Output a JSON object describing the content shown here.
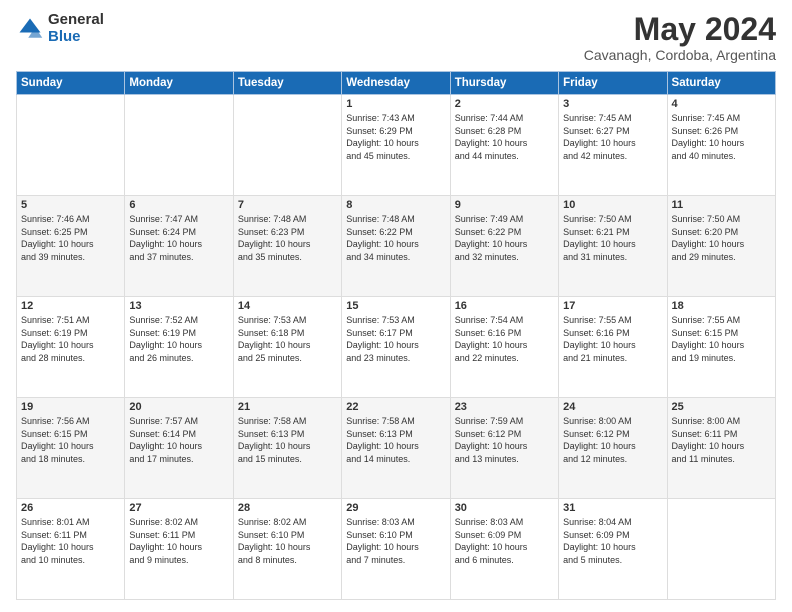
{
  "header": {
    "logo_general": "General",
    "logo_blue": "Blue",
    "main_title": "May 2024",
    "subtitle": "Cavanagh, Cordoba, Argentina"
  },
  "calendar": {
    "days_of_week": [
      "Sunday",
      "Monday",
      "Tuesday",
      "Wednesday",
      "Thursday",
      "Friday",
      "Saturday"
    ],
    "weeks": [
      [
        {
          "day": "",
          "info": ""
        },
        {
          "day": "",
          "info": ""
        },
        {
          "day": "",
          "info": ""
        },
        {
          "day": "1",
          "info": "Sunrise: 7:43 AM\nSunset: 6:29 PM\nDaylight: 10 hours\nand 45 minutes."
        },
        {
          "day": "2",
          "info": "Sunrise: 7:44 AM\nSunset: 6:28 PM\nDaylight: 10 hours\nand 44 minutes."
        },
        {
          "day": "3",
          "info": "Sunrise: 7:45 AM\nSunset: 6:27 PM\nDaylight: 10 hours\nand 42 minutes."
        },
        {
          "day": "4",
          "info": "Sunrise: 7:45 AM\nSunset: 6:26 PM\nDaylight: 10 hours\nand 40 minutes."
        }
      ],
      [
        {
          "day": "5",
          "info": "Sunrise: 7:46 AM\nSunset: 6:25 PM\nDaylight: 10 hours\nand 39 minutes."
        },
        {
          "day": "6",
          "info": "Sunrise: 7:47 AM\nSunset: 6:24 PM\nDaylight: 10 hours\nand 37 minutes."
        },
        {
          "day": "7",
          "info": "Sunrise: 7:48 AM\nSunset: 6:23 PM\nDaylight: 10 hours\nand 35 minutes."
        },
        {
          "day": "8",
          "info": "Sunrise: 7:48 AM\nSunset: 6:22 PM\nDaylight: 10 hours\nand 34 minutes."
        },
        {
          "day": "9",
          "info": "Sunrise: 7:49 AM\nSunset: 6:22 PM\nDaylight: 10 hours\nand 32 minutes."
        },
        {
          "day": "10",
          "info": "Sunrise: 7:50 AM\nSunset: 6:21 PM\nDaylight: 10 hours\nand 31 minutes."
        },
        {
          "day": "11",
          "info": "Sunrise: 7:50 AM\nSunset: 6:20 PM\nDaylight: 10 hours\nand 29 minutes."
        }
      ],
      [
        {
          "day": "12",
          "info": "Sunrise: 7:51 AM\nSunset: 6:19 PM\nDaylight: 10 hours\nand 28 minutes."
        },
        {
          "day": "13",
          "info": "Sunrise: 7:52 AM\nSunset: 6:19 PM\nDaylight: 10 hours\nand 26 minutes."
        },
        {
          "day": "14",
          "info": "Sunrise: 7:53 AM\nSunset: 6:18 PM\nDaylight: 10 hours\nand 25 minutes."
        },
        {
          "day": "15",
          "info": "Sunrise: 7:53 AM\nSunset: 6:17 PM\nDaylight: 10 hours\nand 23 minutes."
        },
        {
          "day": "16",
          "info": "Sunrise: 7:54 AM\nSunset: 6:16 PM\nDaylight: 10 hours\nand 22 minutes."
        },
        {
          "day": "17",
          "info": "Sunrise: 7:55 AM\nSunset: 6:16 PM\nDaylight: 10 hours\nand 21 minutes."
        },
        {
          "day": "18",
          "info": "Sunrise: 7:55 AM\nSunset: 6:15 PM\nDaylight: 10 hours\nand 19 minutes."
        }
      ],
      [
        {
          "day": "19",
          "info": "Sunrise: 7:56 AM\nSunset: 6:15 PM\nDaylight: 10 hours\nand 18 minutes."
        },
        {
          "day": "20",
          "info": "Sunrise: 7:57 AM\nSunset: 6:14 PM\nDaylight: 10 hours\nand 17 minutes."
        },
        {
          "day": "21",
          "info": "Sunrise: 7:58 AM\nSunset: 6:13 PM\nDaylight: 10 hours\nand 15 minutes."
        },
        {
          "day": "22",
          "info": "Sunrise: 7:58 AM\nSunset: 6:13 PM\nDaylight: 10 hours\nand 14 minutes."
        },
        {
          "day": "23",
          "info": "Sunrise: 7:59 AM\nSunset: 6:12 PM\nDaylight: 10 hours\nand 13 minutes."
        },
        {
          "day": "24",
          "info": "Sunrise: 8:00 AM\nSunset: 6:12 PM\nDaylight: 10 hours\nand 12 minutes."
        },
        {
          "day": "25",
          "info": "Sunrise: 8:00 AM\nSunset: 6:11 PM\nDaylight: 10 hours\nand 11 minutes."
        }
      ],
      [
        {
          "day": "26",
          "info": "Sunrise: 8:01 AM\nSunset: 6:11 PM\nDaylight: 10 hours\nand 10 minutes."
        },
        {
          "day": "27",
          "info": "Sunrise: 8:02 AM\nSunset: 6:11 PM\nDaylight: 10 hours\nand 9 minutes."
        },
        {
          "day": "28",
          "info": "Sunrise: 8:02 AM\nSunset: 6:10 PM\nDaylight: 10 hours\nand 8 minutes."
        },
        {
          "day": "29",
          "info": "Sunrise: 8:03 AM\nSunset: 6:10 PM\nDaylight: 10 hours\nand 7 minutes."
        },
        {
          "day": "30",
          "info": "Sunrise: 8:03 AM\nSunset: 6:09 PM\nDaylight: 10 hours\nand 6 minutes."
        },
        {
          "day": "31",
          "info": "Sunrise: 8:04 AM\nSunset: 6:09 PM\nDaylight: 10 hours\nand 5 minutes."
        },
        {
          "day": "",
          "info": ""
        }
      ]
    ]
  }
}
